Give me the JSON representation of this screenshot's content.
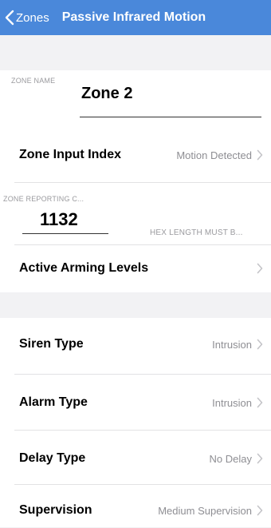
{
  "navbar": {
    "back_label": "Zones",
    "title": "Passive Infrared Motion"
  },
  "zone_name": {
    "caption": "ZONE NAME",
    "value": "Zone 2"
  },
  "zone_input_index": {
    "label": "Zone Input Index",
    "value": "Motion Detected"
  },
  "zone_reporting_code": {
    "caption": "ZONE REPORTING C...",
    "value": "1132",
    "hint": "HEX LENGTH MUST B..."
  },
  "active_arming_levels": {
    "label": "Active Arming Levels",
    "value": ""
  },
  "settings": [
    {
      "label": "Siren Type",
      "value": "Intrusion"
    },
    {
      "label": "Alarm Type",
      "value": "Intrusion"
    },
    {
      "label": "Delay Type",
      "value": "No Delay"
    },
    {
      "label": "Supervision",
      "value": "Medium Supervision"
    }
  ],
  "colors": {
    "navbar": "#4a88da",
    "background": "#f2f2f4",
    "secondary_text": "#8e8e93"
  }
}
